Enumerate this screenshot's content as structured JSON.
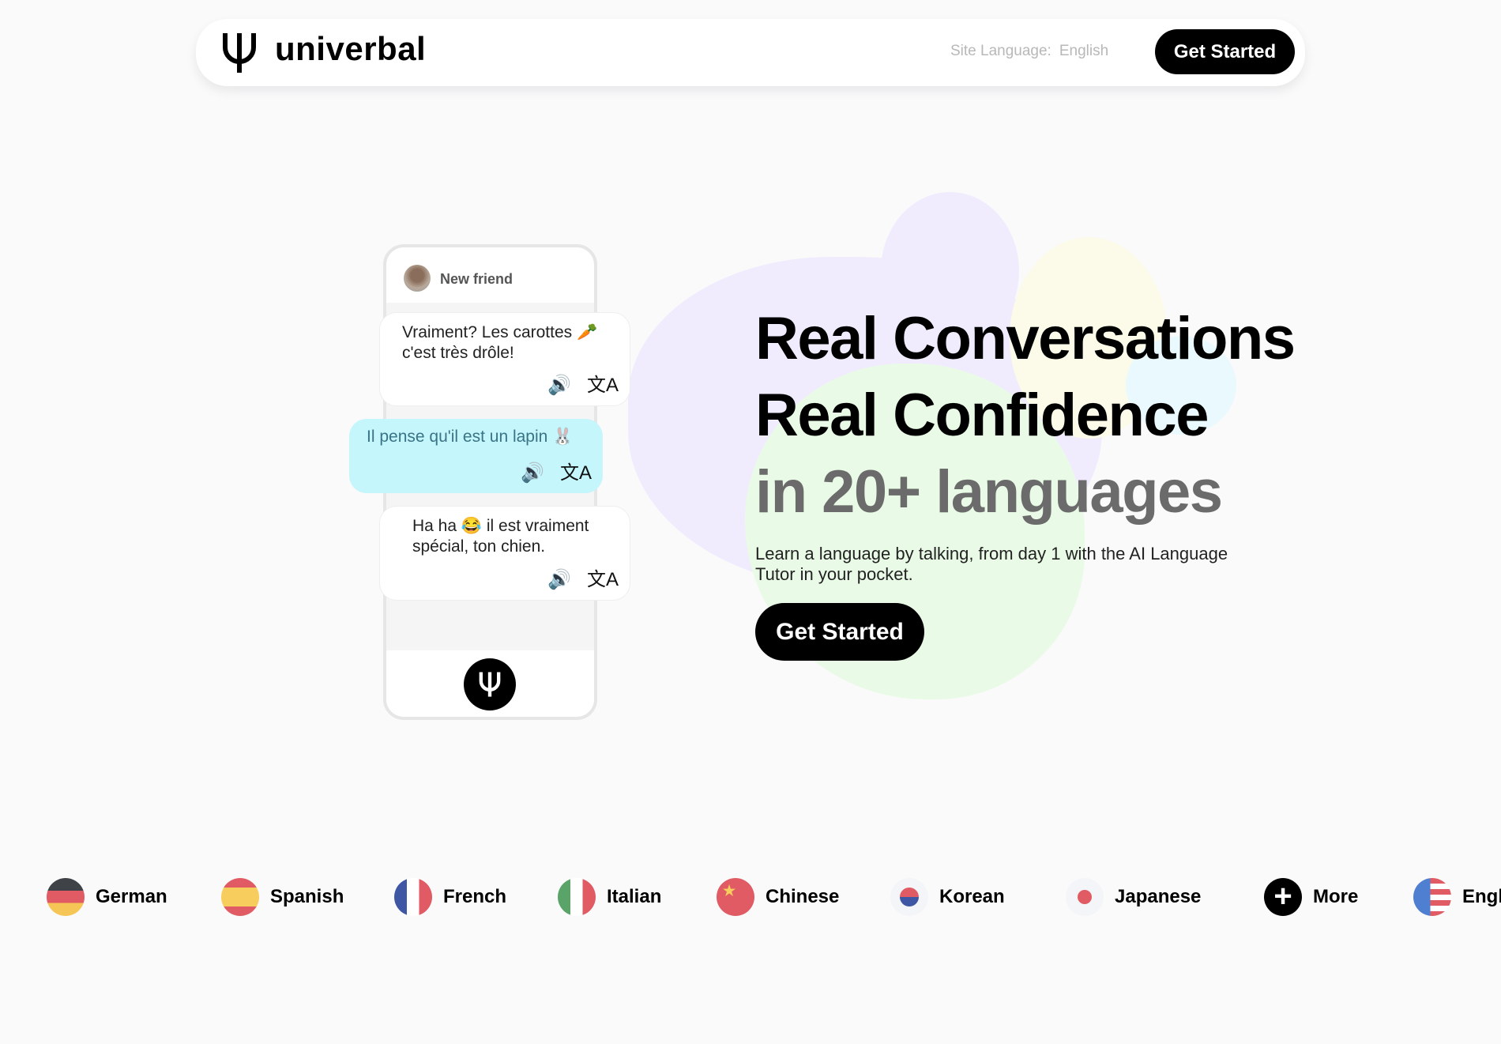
{
  "header": {
    "brand": "univerbal",
    "site_language_label": "Site Language:",
    "site_language_value": "English",
    "get_started": "Get Started"
  },
  "chat": {
    "contact_name": "New friend",
    "messages": [
      {
        "text": "Vraiment? Les carottes 🥕 c'est très drôle!",
        "from": "other"
      },
      {
        "text": "Il pense qu'il est un lapin 🐰",
        "from": "me"
      },
      {
        "text": "Ha ha 😂 il est vraiment spécial, ton chien.",
        "from": "other"
      }
    ],
    "speaker_icon": "🔊",
    "translate_icon": "文A"
  },
  "hero": {
    "line1": "Real Conversations",
    "line2": "Real Confidence",
    "line3": "in 20+ languages",
    "subtitle": "Learn a language by talking, from day 1 with the AI Language Tutor in your pocket.",
    "cta": "Get Started"
  },
  "languages": [
    {
      "label": "German",
      "flag": "de"
    },
    {
      "label": "Spanish",
      "flag": "es"
    },
    {
      "label": "French",
      "flag": "fr"
    },
    {
      "label": "Italian",
      "flag": "it"
    },
    {
      "label": "Chinese",
      "flag": "cn"
    },
    {
      "label": "Korean",
      "flag": "kr"
    },
    {
      "label": "Japanese",
      "flag": "jp"
    },
    {
      "label": "More",
      "flag": "plus"
    },
    {
      "label": "Engl",
      "flag": "us"
    }
  ],
  "colors": {
    "accent": "#000000",
    "bubble_me": "#c4f6fb",
    "blob_purple": "#f0ecfd",
    "blob_green": "#e9fbe6",
    "blob_yellow": "#fcfbe9"
  }
}
